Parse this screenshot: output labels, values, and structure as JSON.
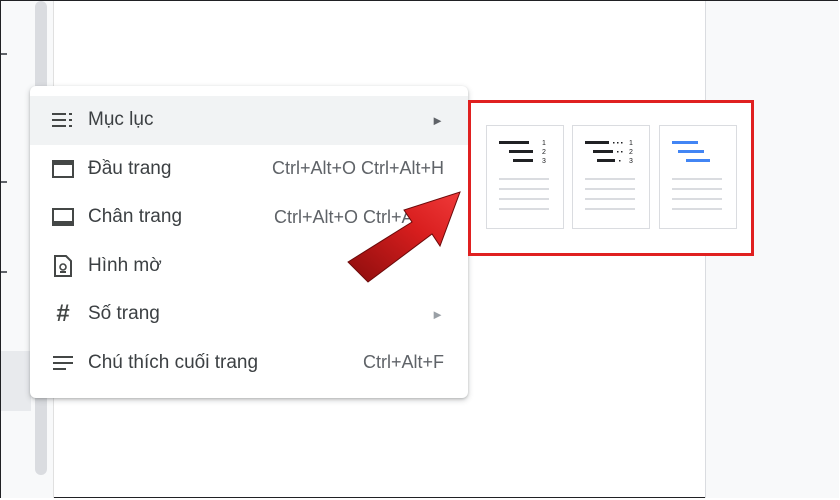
{
  "menu": {
    "items": [
      {
        "label": "Mục lục",
        "shortcut": "",
        "submenu": true,
        "icon": "list-icon",
        "active": true
      },
      {
        "label": "Đầu trang",
        "shortcut": "Ctrl+Alt+O Ctrl+Alt+H",
        "submenu": false,
        "icon": "header-icon"
      },
      {
        "label": "Chân trang",
        "shortcut": "Ctrl+Alt+O Ctrl+Alt+F",
        "submenu": false,
        "icon": "footer-icon"
      },
      {
        "label": "Hình mờ",
        "shortcut": "",
        "submenu": false,
        "icon": "watermark-icon"
      },
      {
        "label": "Số trang",
        "shortcut": "",
        "submenu": true,
        "icon": "hash-icon"
      },
      {
        "label": "Chú thích cuối trang",
        "shortcut": "Ctrl+Alt+F",
        "submenu": false,
        "icon": "footnote-icon"
      }
    ],
    "submenu_arrow": "►"
  },
  "toc_options": [
    {
      "style": "plain-text-numbers",
      "icon": "toc-plain-text-icon",
      "numbers": [
        "1",
        "2",
        "3"
      ]
    },
    {
      "style": "dotted-numbers",
      "icon": "toc-dotted-icon",
      "numbers": [
        "1",
        "2",
        "3"
      ]
    },
    {
      "style": "blue-links",
      "icon": "toc-blue-links-icon",
      "numbers": []
    }
  ],
  "colors": {
    "highlight_box": "#e02020",
    "arrow": "#d81e1e",
    "link_blue": "#4285f4",
    "menu_text": "#3c4043"
  }
}
